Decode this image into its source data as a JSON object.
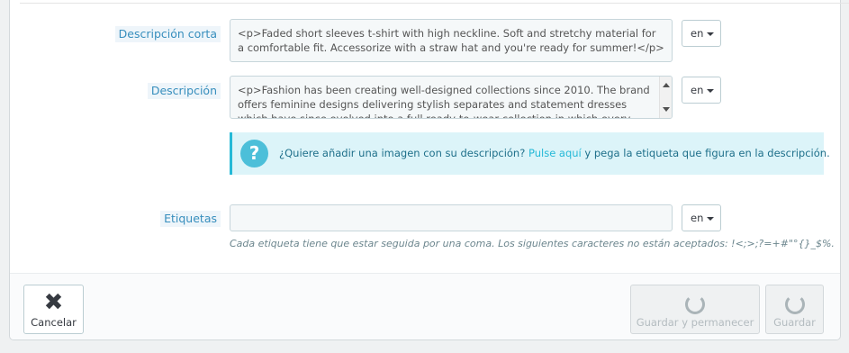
{
  "short_description": {
    "label": "Descripción corta",
    "value": "<p>Faded short sleeves t-shirt with high neckline. Soft and stretchy material for a comfortable fit. Accessorize with a straw hat and you're ready for summer!</p>",
    "lang": "en"
  },
  "description": {
    "label": "Descripción",
    "value": "<p>Fashion has been creating well-designed collections since 2010. The brand offers feminine designs delivering stylish separates and statement dresses which have since evolved into a full ready-to-wear collection in which every item is a vital",
    "lang": "en"
  },
  "info": {
    "icon": "question-icon",
    "text_before": "¿Quiere añadir una imagen con su descripción? ",
    "link": "Pulse aquí",
    "text_after": " y pega la etiqueta que figura en la descripción."
  },
  "tags": {
    "label": "Etiquetas",
    "value": "",
    "lang": "en",
    "help": "Cada etiqueta tiene que estar seguida por una coma. Los siguientes caracteres no están aceptados: !<;>;?=+#\"°{}_$%."
  },
  "footer": {
    "cancel_label": "Cancelar",
    "save_stay_label": "Guardar y permanecer",
    "save_label": "Guardar"
  }
}
